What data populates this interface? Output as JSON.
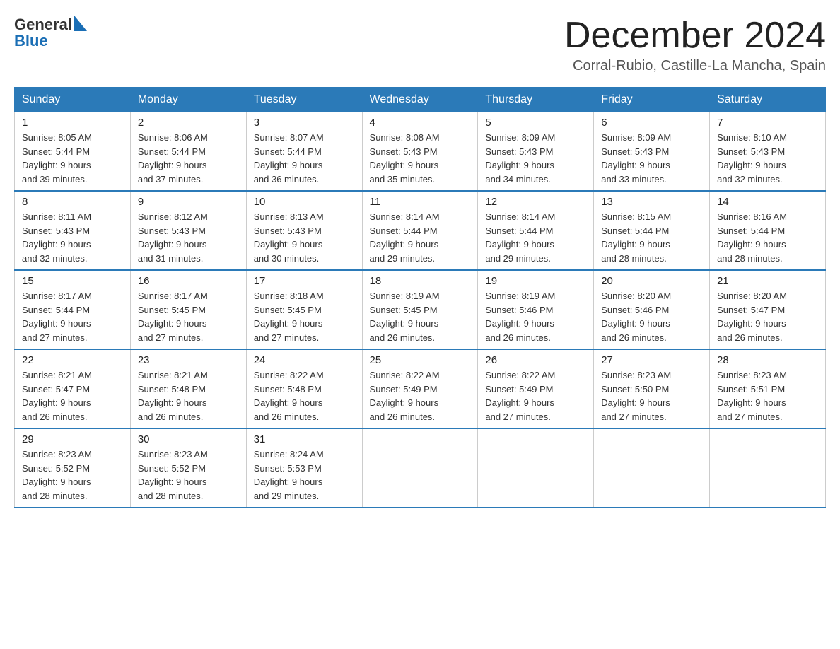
{
  "header": {
    "logo_text_general": "General",
    "logo_text_blue": "Blue",
    "calendar_title": "December 2024",
    "calendar_subtitle": "Corral-Rubio, Castille-La Mancha, Spain"
  },
  "days_of_week": [
    "Sunday",
    "Monday",
    "Tuesday",
    "Wednesday",
    "Thursday",
    "Friday",
    "Saturday"
  ],
  "weeks": [
    [
      {
        "day": "1",
        "sunrise": "8:05 AM",
        "sunset": "5:44 PM",
        "daylight": "9 hours and 39 minutes."
      },
      {
        "day": "2",
        "sunrise": "8:06 AM",
        "sunset": "5:44 PM",
        "daylight": "9 hours and 37 minutes."
      },
      {
        "day": "3",
        "sunrise": "8:07 AM",
        "sunset": "5:44 PM",
        "daylight": "9 hours and 36 minutes."
      },
      {
        "day": "4",
        "sunrise": "8:08 AM",
        "sunset": "5:43 PM",
        "daylight": "9 hours and 35 minutes."
      },
      {
        "day": "5",
        "sunrise": "8:09 AM",
        "sunset": "5:43 PM",
        "daylight": "9 hours and 34 minutes."
      },
      {
        "day": "6",
        "sunrise": "8:09 AM",
        "sunset": "5:43 PM",
        "daylight": "9 hours and 33 minutes."
      },
      {
        "day": "7",
        "sunrise": "8:10 AM",
        "sunset": "5:43 PM",
        "daylight": "9 hours and 32 minutes."
      }
    ],
    [
      {
        "day": "8",
        "sunrise": "8:11 AM",
        "sunset": "5:43 PM",
        "daylight": "9 hours and 32 minutes."
      },
      {
        "day": "9",
        "sunrise": "8:12 AM",
        "sunset": "5:43 PM",
        "daylight": "9 hours and 31 minutes."
      },
      {
        "day": "10",
        "sunrise": "8:13 AM",
        "sunset": "5:43 PM",
        "daylight": "9 hours and 30 minutes."
      },
      {
        "day": "11",
        "sunrise": "8:14 AM",
        "sunset": "5:44 PM",
        "daylight": "9 hours and 29 minutes."
      },
      {
        "day": "12",
        "sunrise": "8:14 AM",
        "sunset": "5:44 PM",
        "daylight": "9 hours and 29 minutes."
      },
      {
        "day": "13",
        "sunrise": "8:15 AM",
        "sunset": "5:44 PM",
        "daylight": "9 hours and 28 minutes."
      },
      {
        "day": "14",
        "sunrise": "8:16 AM",
        "sunset": "5:44 PM",
        "daylight": "9 hours and 28 minutes."
      }
    ],
    [
      {
        "day": "15",
        "sunrise": "8:17 AM",
        "sunset": "5:44 PM",
        "daylight": "9 hours and 27 minutes."
      },
      {
        "day": "16",
        "sunrise": "8:17 AM",
        "sunset": "5:45 PM",
        "daylight": "9 hours and 27 minutes."
      },
      {
        "day": "17",
        "sunrise": "8:18 AM",
        "sunset": "5:45 PM",
        "daylight": "9 hours and 27 minutes."
      },
      {
        "day": "18",
        "sunrise": "8:19 AM",
        "sunset": "5:45 PM",
        "daylight": "9 hours and 26 minutes."
      },
      {
        "day": "19",
        "sunrise": "8:19 AM",
        "sunset": "5:46 PM",
        "daylight": "9 hours and 26 minutes."
      },
      {
        "day": "20",
        "sunrise": "8:20 AM",
        "sunset": "5:46 PM",
        "daylight": "9 hours and 26 minutes."
      },
      {
        "day": "21",
        "sunrise": "8:20 AM",
        "sunset": "5:47 PM",
        "daylight": "9 hours and 26 minutes."
      }
    ],
    [
      {
        "day": "22",
        "sunrise": "8:21 AM",
        "sunset": "5:47 PM",
        "daylight": "9 hours and 26 minutes."
      },
      {
        "day": "23",
        "sunrise": "8:21 AM",
        "sunset": "5:48 PM",
        "daylight": "9 hours and 26 minutes."
      },
      {
        "day": "24",
        "sunrise": "8:22 AM",
        "sunset": "5:48 PM",
        "daylight": "9 hours and 26 minutes."
      },
      {
        "day": "25",
        "sunrise": "8:22 AM",
        "sunset": "5:49 PM",
        "daylight": "9 hours and 26 minutes."
      },
      {
        "day": "26",
        "sunrise": "8:22 AM",
        "sunset": "5:49 PM",
        "daylight": "9 hours and 27 minutes."
      },
      {
        "day": "27",
        "sunrise": "8:23 AM",
        "sunset": "5:50 PM",
        "daylight": "9 hours and 27 minutes."
      },
      {
        "day": "28",
        "sunrise": "8:23 AM",
        "sunset": "5:51 PM",
        "daylight": "9 hours and 27 minutes."
      }
    ],
    [
      {
        "day": "29",
        "sunrise": "8:23 AM",
        "sunset": "5:52 PM",
        "daylight": "9 hours and 28 minutes."
      },
      {
        "day": "30",
        "sunrise": "8:23 AM",
        "sunset": "5:52 PM",
        "daylight": "9 hours and 28 minutes."
      },
      {
        "day": "31",
        "sunrise": "8:24 AM",
        "sunset": "5:53 PM",
        "daylight": "9 hours and 29 minutes."
      },
      null,
      null,
      null,
      null
    ]
  ],
  "labels": {
    "sunrise_prefix": "Sunrise: ",
    "sunset_prefix": "Sunset: ",
    "daylight_prefix": "Daylight: "
  }
}
